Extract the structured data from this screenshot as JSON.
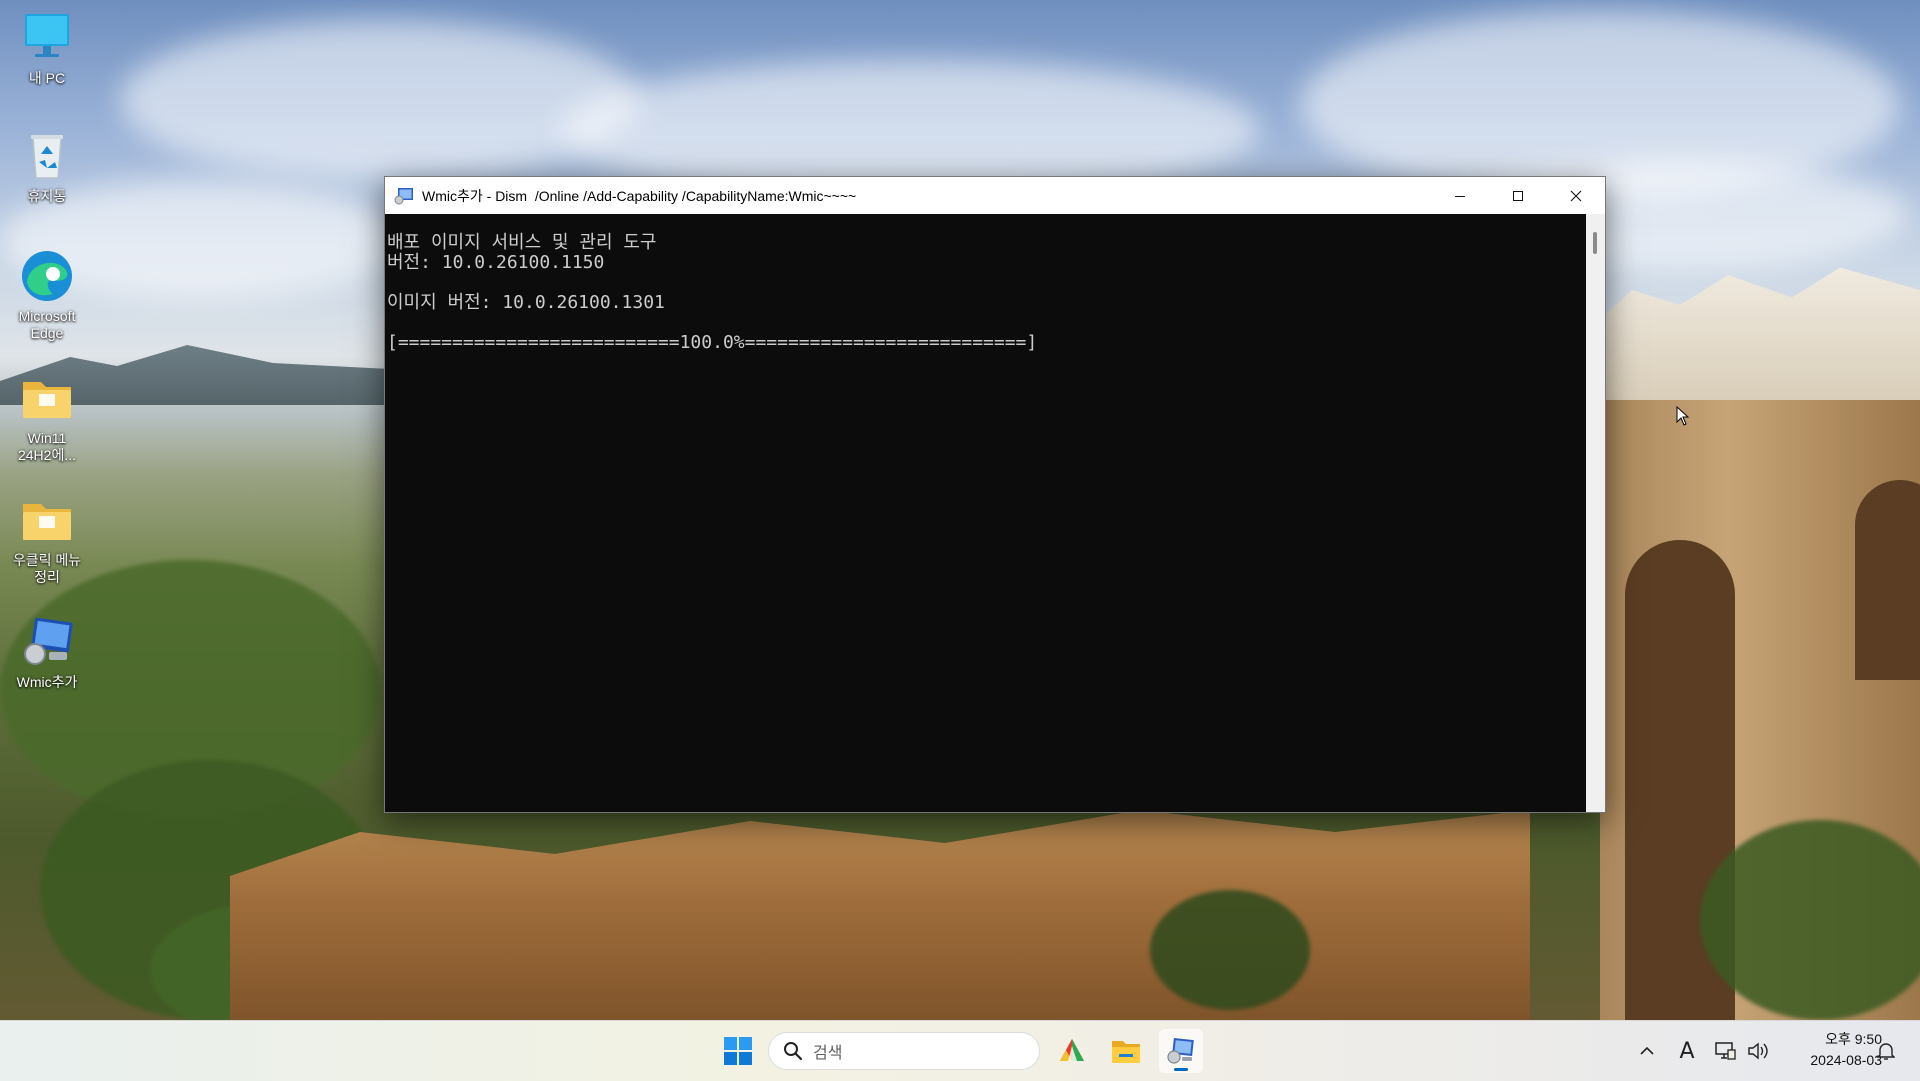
{
  "desktop": {
    "icons": [
      {
        "label": "내 PC",
        "icon": "computer-icon"
      },
      {
        "label": "휴지통",
        "icon": "recycle-bin-icon"
      },
      {
        "label": "Microsoft\nEdge",
        "icon": "edge-icon"
      },
      {
        "label": "Win11\n24H2에...",
        "icon": "folder-icon"
      },
      {
        "label": "우클릭 메뉴\n정리",
        "icon": "folder-icon"
      },
      {
        "label": "Wmic추가",
        "icon": "wmic-shortcut-icon"
      }
    ]
  },
  "window": {
    "title": "Wmic추가 - Dism  /Online /Add-Capability /CapabilityName:Wmic~~~~",
    "controls": {
      "minimize": "minimize-icon",
      "maximize": "maximize-icon",
      "close": "close-icon"
    },
    "console_lines": [
      "배포 이미지 서비스 및 관리 도구",
      "버전: 10.0.26100.1150",
      "",
      "이미지 버전: 10.0.26100.1301",
      "",
      "[==========================100.0%==========================]"
    ],
    "progress_percent": 100.0
  },
  "taskbar": {
    "search_placeholder": "검색",
    "apps": [
      {
        "name": "start",
        "icon": "windows-logo-icon"
      },
      {
        "name": "app",
        "icon": "colorful-app-icon"
      },
      {
        "name": "file-explorer",
        "icon": "file-explorer-icon"
      },
      {
        "name": "wmic-console",
        "icon": "console-app-icon",
        "active": true
      }
    ],
    "tray": {
      "chevron": "chevron-up-icon",
      "ime": "A",
      "network": "network-icon",
      "volume": "speaker-icon",
      "notifications": "bell-icon"
    },
    "clock": {
      "time": "오후 9:50",
      "date": "2024-08-03"
    }
  },
  "colors": {
    "console_bg": "#0c0c0c",
    "console_fg": "#cccccc",
    "accent": "#0067c0"
  }
}
